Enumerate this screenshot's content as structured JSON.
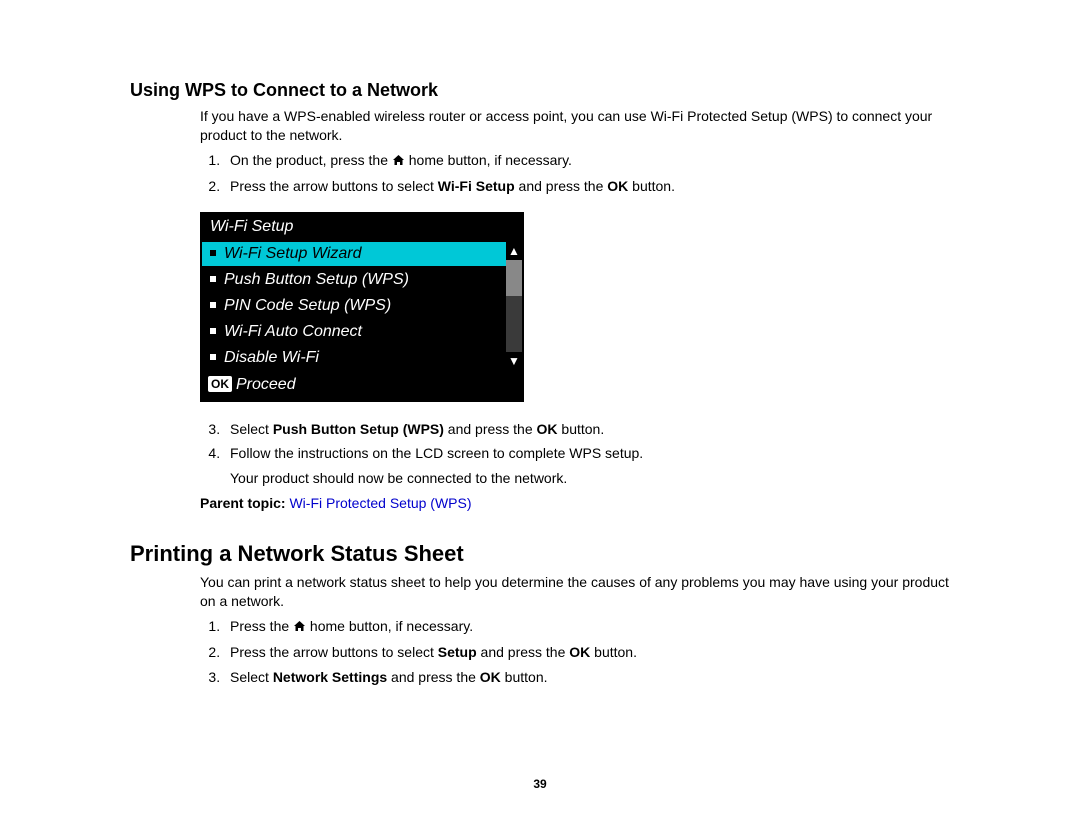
{
  "section1": {
    "heading": "Using WPS to Connect to a Network",
    "intro": "If you have a WPS-enabled wireless router or access point, you can use Wi-Fi Protected Setup (WPS) to connect your product to the network.",
    "step1_a": "On the product, press the ",
    "step1_b": " home button, if necessary.",
    "step2_a": "Press the arrow buttons to select ",
    "step2_bold1": "Wi-Fi Setup",
    "step2_b": " and press the ",
    "step2_bold2": "OK",
    "step2_c": " button.",
    "step3_a": "Select ",
    "step3_bold1": "Push Button Setup (WPS)",
    "step3_b": " and press the ",
    "step3_bold2": "OK",
    "step3_c": " button.",
    "step4": "Follow the instructions on the LCD screen to complete WPS setup.",
    "step4_note": "Your product should now be connected to the network.",
    "parent_label": "Parent topic: ",
    "parent_link": "Wi-Fi Protected Setup (WPS)"
  },
  "lcd": {
    "title": "Wi-Fi Setup",
    "items": [
      "Wi-Fi Setup Wizard",
      "Push Button Setup (WPS)",
      "PIN Code Setup (WPS)",
      "Wi-Fi Auto Connect",
      "Disable Wi-Fi"
    ],
    "ok_label": "OK",
    "footer": "Proceed"
  },
  "section2": {
    "heading": "Printing a Network Status Sheet",
    "intro": "You can print a network status sheet to help you determine the causes of any problems you may have using your product on a network.",
    "step1_a": "Press the ",
    "step1_b": " home button, if necessary.",
    "step2_a": "Press the arrow buttons to select ",
    "step2_bold1": "Setup",
    "step2_b": " and press the ",
    "step2_bold2": "OK",
    "step2_c": " button.",
    "step3_a": "Select ",
    "step3_bold1": "Network Settings",
    "step3_b": " and press the ",
    "step3_bold2": "OK",
    "step3_c": " button."
  },
  "page_number": "39"
}
